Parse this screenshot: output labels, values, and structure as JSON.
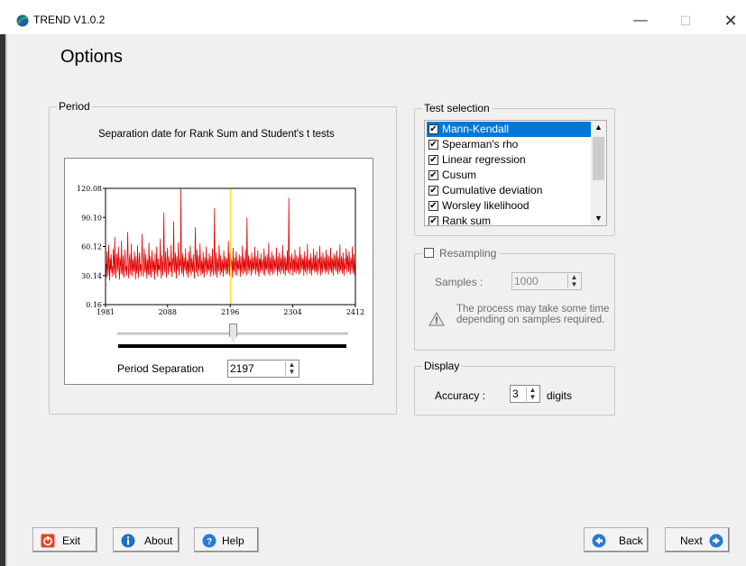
{
  "window": {
    "title": "TREND V1.0.2",
    "min_glyph": "—",
    "max_glyph": "☐",
    "close_glyph": "✕"
  },
  "page": {
    "title": "Options"
  },
  "period": {
    "legend": "Period",
    "caption": "Separation date for Rank Sum and Student's t tests",
    "separation_label": "Period Separation",
    "separation_value": "2197",
    "slider_fraction": 0.5
  },
  "chart_data": {
    "type": "line",
    "x_ticks": [
      "1981",
      "2088",
      "2196",
      "2304",
      "2412"
    ],
    "y_ticks": [
      "0.16",
      "30.14",
      "60.12",
      "90.10",
      "120.08"
    ],
    "xlim": [
      1981,
      2412
    ],
    "ylim": [
      0.16,
      120.08
    ],
    "series_color": "#e00000",
    "marker_color": "#ffd400",
    "marker_x": 2197,
    "values": [
      35,
      42,
      28,
      55,
      38,
      30,
      62,
      44,
      25,
      48,
      36,
      52,
      33,
      40,
      29,
      58,
      45,
      31,
      70,
      39,
      27,
      46,
      53,
      34,
      41,
      60,
      37,
      26,
      49,
      43,
      32,
      66,
      38,
      30,
      51,
      42,
      28,
      45,
      57,
      35,
      40,
      30,
      48,
      75,
      38,
      27,
      44,
      52,
      36,
      31,
      63,
      41,
      29,
      47,
      39,
      34,
      55,
      43,
      26,
      50,
      37,
      32,
      61,
      40,
      28,
      46,
      54,
      35,
      42,
      30,
      49,
      73,
      38,
      29,
      45,
      58,
      36,
      33,
      52,
      41,
      27,
      47,
      39,
      31,
      64,
      44,
      30,
      50,
      37,
      28,
      56,
      42,
      34,
      46,
      40,
      26,
      53,
      38,
      32,
      60,
      45,
      29,
      48,
      36,
      41,
      35,
      68,
      39,
      27,
      51,
      43,
      30,
      47,
      95,
      38,
      33,
      55,
      42,
      28,
      46,
      59,
      37,
      31,
      50,
      40,
      44,
      34,
      62,
      36,
      29,
      48,
      41,
      86,
      39,
      33,
      54,
      45,
      27,
      50,
      38,
      35,
      64,
      42,
      30,
      47,
      40,
      120,
      36,
      32,
      53,
      44,
      29,
      49,
      41,
      35,
      58,
      38,
      31,
      46,
      43,
      28,
      55,
      37,
      33,
      61,
      45,
      30,
      48,
      40,
      34,
      52,
      39,
      27,
      47,
      80,
      36,
      33,
      57,
      42,
      29,
      51,
      38,
      35,
      63,
      44,
      30,
      46,
      40,
      32,
      55,
      37,
      28,
      49,
      43,
      34,
      60,
      41,
      31,
      47,
      38,
      35,
      53,
      45,
      29,
      50,
      39,
      33,
      58,
      42,
      30,
      46,
      100,
      36,
      31,
      54,
      43,
      28,
      48,
      40,
      34,
      62,
      45,
      30,
      51,
      37,
      33,
      47,
      41,
      29,
      56,
      39,
      35,
      50,
      44,
      31,
      48,
      38,
      32,
      66,
      42,
      30,
      53,
      40,
      35,
      47,
      43,
      28,
      59,
      37,
      34,
      49,
      41,
      31,
      55,
      44,
      30,
      46,
      39,
      36,
      52,
      42,
      29,
      50,
      38,
      33,
      61,
      45,
      31,
      48,
      40,
      34,
      57,
      37,
      30,
      90,
      43,
      32,
      51,
      39,
      35,
      47,
      44,
      30,
      54,
      41,
      33,
      49,
      38,
      36,
      60,
      42,
      31,
      50,
      40,
      34,
      56,
      37,
      29,
      48,
      45,
      33,
      53,
      39,
      35,
      47,
      42,
      31,
      58,
      44,
      30,
      50,
      38,
      36,
      52,
      41,
      32,
      64,
      43,
      30,
      49,
      39,
      34,
      55,
      37,
      31,
      51,
      45,
      33,
      47,
      40,
      36,
      59,
      42,
      30,
      50,
      38,
      34,
      54,
      44,
      31,
      48,
      41,
      35,
      62,
      39,
      32,
      51,
      43,
      30,
      49,
      37,
      35,
      56,
      40,
      33,
      110,
      45,
      31,
      50,
      38,
      36,
      53,
      42,
      30,
      48,
      44,
      34,
      57,
      39,
      32,
      51,
      41,
      35,
      49,
      37,
      31,
      60,
      43,
      33,
      52,
      40,
      36,
      48,
      45,
      30,
      55,
      38,
      34,
      50,
      42,
      31,
      63,
      39,
      35,
      47,
      44,
      32,
      53,
      41,
      30,
      49,
      37,
      36,
      58,
      43,
      33,
      51,
      40,
      34,
      55,
      38,
      31,
      48,
      45,
      35,
      61,
      42,
      30,
      50,
      39,
      33,
      54,
      44,
      36,
      49,
      41,
      32,
      57,
      37,
      34,
      52,
      43,
      31,
      50,
      40,
      35,
      59,
      38,
      33,
      48,
      45,
      30,
      53,
      42,
      36,
      51,
      39,
      34,
      56,
      44,
      31,
      49,
      41,
      33,
      62,
      37,
      35,
      50,
      43,
      32,
      54,
      40,
      30,
      48,
      38,
      36,
      58,
      45,
      33,
      51,
      42,
      34,
      55,
      39,
      31,
      49,
      44,
      35,
      60,
      41,
      32,
      52,
      37,
      30,
      50
    ]
  },
  "tests": {
    "legend": "Test selection",
    "items": [
      {
        "label": "Mann-Kendall",
        "checked": true,
        "selected": true
      },
      {
        "label": "Spearman's rho",
        "checked": true
      },
      {
        "label": "Linear regression",
        "checked": true
      },
      {
        "label": "Cusum",
        "checked": true
      },
      {
        "label": "Cumulative deviation",
        "checked": true
      },
      {
        "label": "Worsley likelihood",
        "checked": true
      },
      {
        "label": "Rank sum",
        "checked": true
      }
    ],
    "check_glyph": "✔"
  },
  "resampling": {
    "label": "Resampling",
    "checked": false,
    "samples_label": "Samples :",
    "samples_value": "1000",
    "warning": "The process may take some time depending on samples required."
  },
  "display": {
    "legend": "Display",
    "accuracy_label": "Accuracy :",
    "accuracy_value": "3",
    "digits_label": "digits"
  },
  "buttons": {
    "exit": "Exit",
    "about": "About",
    "help": "Help",
    "back": "Back",
    "next": "Next"
  },
  "spin_arrows": "▲\n▼"
}
